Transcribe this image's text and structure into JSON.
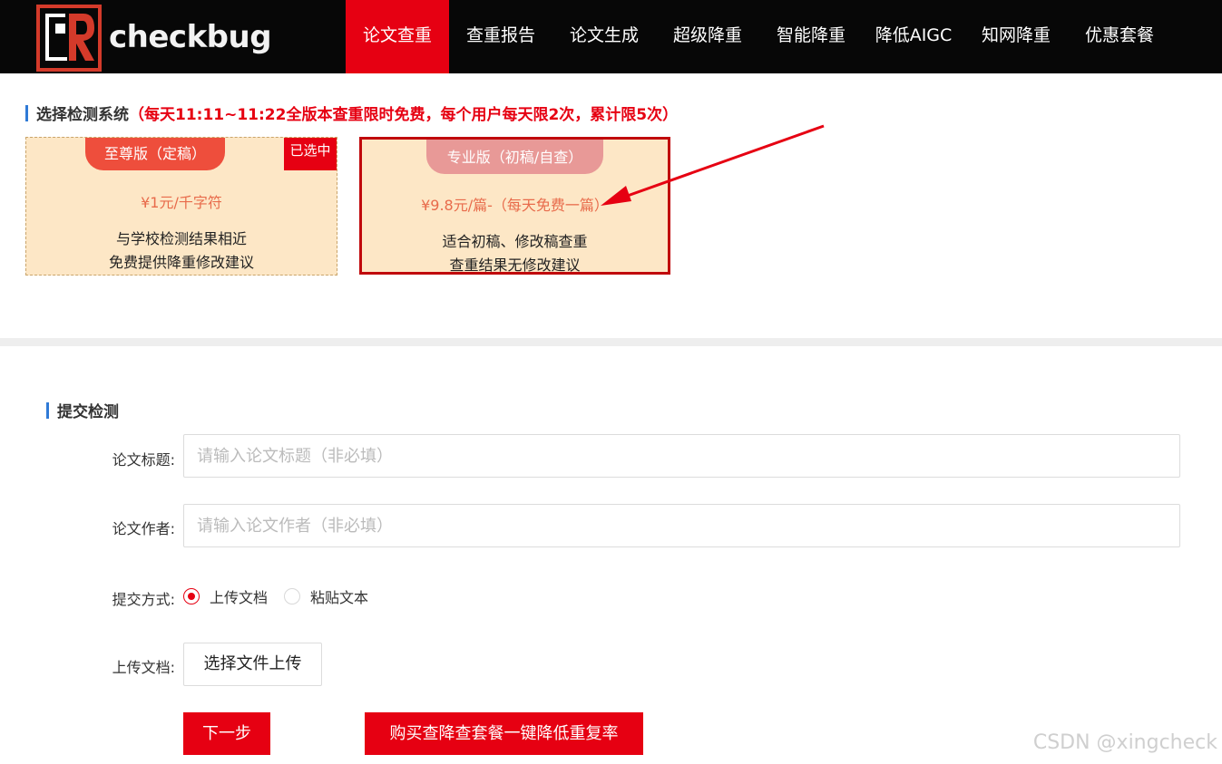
{
  "header": {
    "logo_text": "checkbug",
    "nav": [
      {
        "label": "论文查重",
        "active": true
      },
      {
        "label": "查重报告",
        "active": false
      },
      {
        "label": "论文生成",
        "active": false
      },
      {
        "label": "超级降重",
        "active": false
      },
      {
        "label": "智能降重",
        "active": false
      },
      {
        "label": "降低AIGC",
        "active": false
      },
      {
        "label": "知网降重",
        "active": false
      },
      {
        "label": "优惠套餐",
        "active": false
      }
    ]
  },
  "select_section": {
    "title": "选择检测系统",
    "promo": "（每天11:11~11:22全版本查重限时免费，每个用户每天限2次，累计限5次）",
    "plans": [
      {
        "tab": "至尊版（定稿）",
        "badge": "已选中",
        "price": "¥1元/千字符",
        "desc_line1": "与学校检测结果相近",
        "desc_line2": "免费提供降重修改建议"
      },
      {
        "tab": "专业版（初稿/自查）",
        "price": "¥9.8元/篇-（每天免费一篇）",
        "desc_line1": "适合初稿、修改稿查重",
        "desc_line2": "查重结果无修改建议"
      }
    ]
  },
  "submit_section": {
    "title": "提交检测",
    "title_label": "论文标题:",
    "title_placeholder": "请输入论文标题（非必填）",
    "author_label": "论文作者:",
    "author_placeholder": "请输入论文作者（非必填）",
    "method_label": "提交方式:",
    "method_options": [
      {
        "label": "上传文档",
        "checked": true
      },
      {
        "label": "粘贴文本",
        "checked": false
      }
    ],
    "upload_label": "上传文档:",
    "upload_button": "选择文件上传",
    "next_button": "下一步",
    "buy_button": "购买查降查套餐一键降低重复率"
  },
  "watermark": "CSDN @xingcheck",
  "colors": {
    "nav_bg": "#070707",
    "accent_red": "#e60012",
    "card_bg": "#fde7c6",
    "section_bar": "#2f7ad6"
  }
}
